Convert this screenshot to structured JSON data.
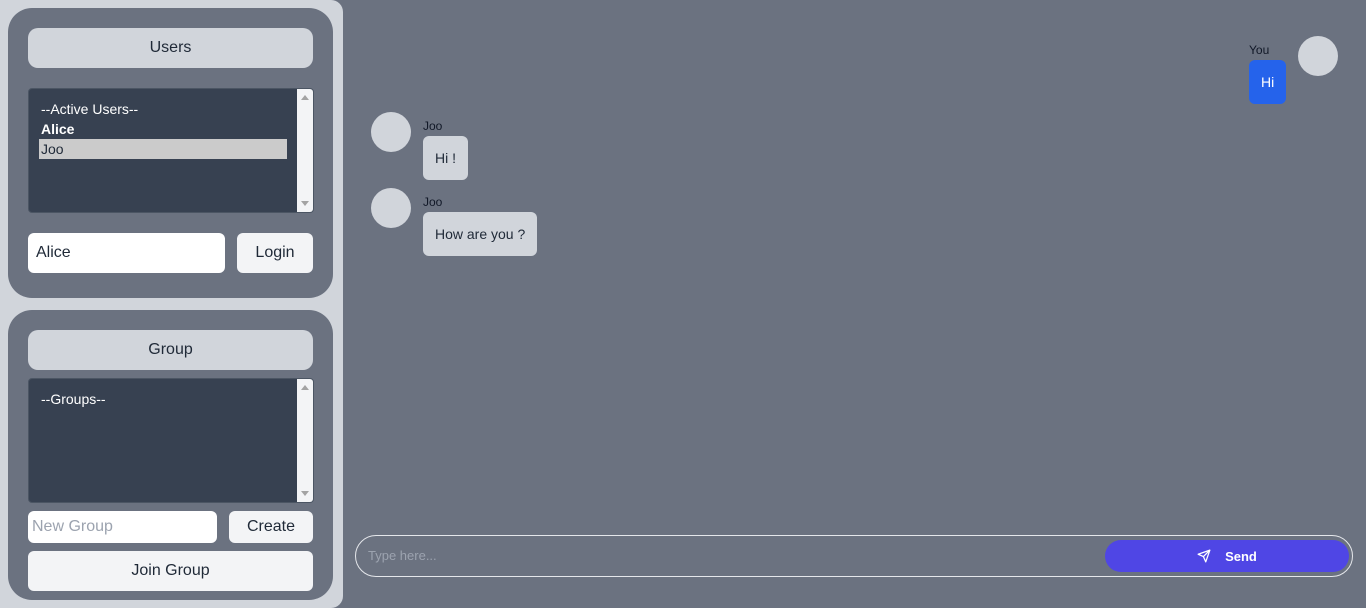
{
  "users_panel": {
    "header": "Users",
    "options": [
      "--Active Users--",
      "Alice",
      "Joo"
    ],
    "selected": "Joo",
    "name_value": "Alice",
    "login_label": "Login"
  },
  "group_panel": {
    "header": "Group",
    "options": [
      "--Groups--"
    ],
    "new_group_placeholder": "New Group",
    "create_label": "Create",
    "join_label": "Join Group"
  },
  "messages": [
    {
      "sender": "You",
      "text": "Hi",
      "direction": "outgoing"
    },
    {
      "sender": "Joo",
      "text": "Hi !",
      "direction": "incoming"
    },
    {
      "sender": "Joo",
      "text": "How are you ?",
      "direction": "incoming"
    }
  ],
  "composer": {
    "placeholder": "Type here...",
    "send_label": "Send",
    "send_icon": "paper-plane-icon"
  },
  "colors": {
    "page_bg": "#6b7280",
    "sidebar_bg": "#d1d5db",
    "listbox_bg": "#374151",
    "outgoing_bubble": "#2563eb",
    "send_button": "#4f46e5"
  }
}
